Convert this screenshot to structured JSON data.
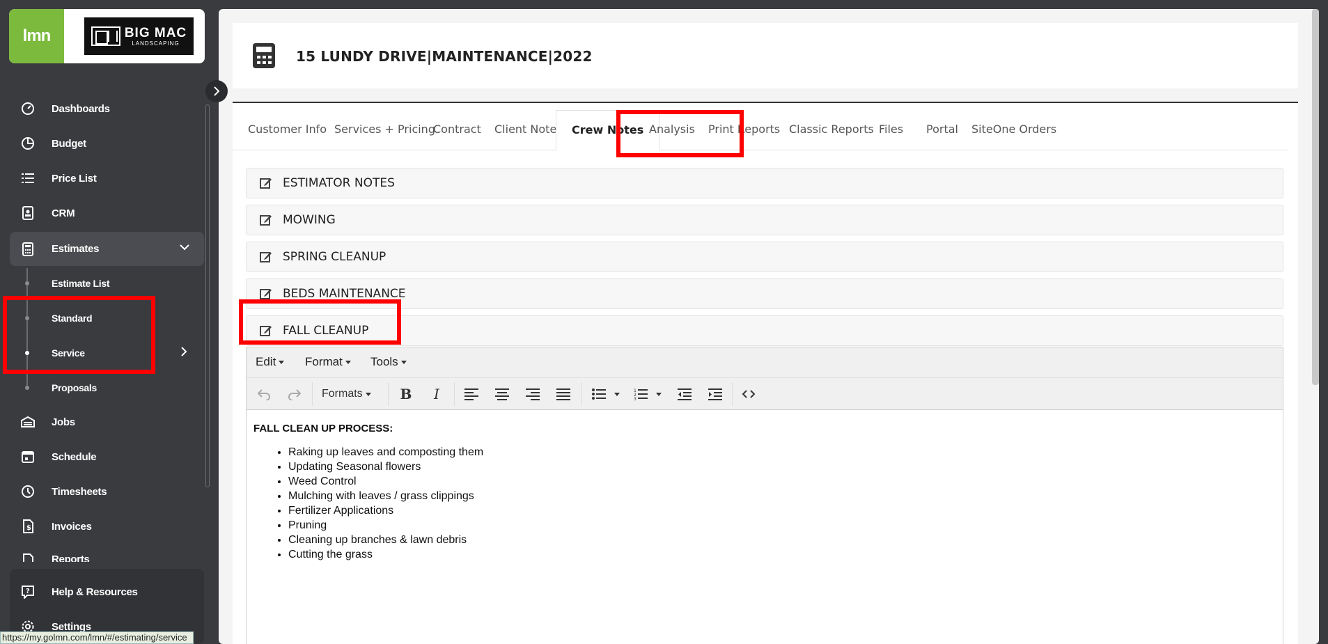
{
  "brand": {
    "lmn": "lmn",
    "company_big": "BIG MAC",
    "company_small": "LANDSCAPING"
  },
  "sidebar": {
    "items": [
      {
        "label": "Dashboards",
        "icon": "dashboard-gauge-icon"
      },
      {
        "label": "Budget",
        "icon": "pie-chart-icon"
      },
      {
        "label": "Price List",
        "icon": "list-icon"
      },
      {
        "label": "CRM",
        "icon": "contact-card-icon"
      },
      {
        "label": "Estimates",
        "icon": "calculator-icon"
      },
      {
        "label": "Jobs",
        "icon": "stack-icon"
      },
      {
        "label": "Schedule",
        "icon": "calendar-icon"
      },
      {
        "label": "Timesheets",
        "icon": "clock-icon"
      },
      {
        "label": "Invoices",
        "icon": "invoice-icon"
      },
      {
        "label": "Reports",
        "icon": "report-icon"
      }
    ],
    "estimates_sub": [
      "Estimate List",
      "Standard",
      "Service",
      "Proposals"
    ],
    "bottom": [
      {
        "label": "Help & Resources",
        "icon": "help-icon"
      },
      {
        "label": "Settings",
        "icon": "gear-icon"
      }
    ]
  },
  "status_url": "https://my.golmn.com/lmn/#/estimating/service",
  "page": {
    "title": "15 LUNDY DRIVE|MAINTENANCE|2022"
  },
  "tabs": [
    "Customer Info",
    "Services + Pricing",
    "Contract",
    "Client Notes",
    "Crew Notes",
    "Analysis",
    "Print Reports",
    "Classic Reports",
    "Files",
    "Portal",
    "SiteOne Orders"
  ],
  "active_tab": "Crew Notes",
  "panels": [
    "ESTIMATOR NOTES",
    "MOWING",
    "SPRING CLEANUP",
    "BEDS MAINTENANCE",
    "FALL CLEANUP"
  ],
  "editor": {
    "menus": [
      "Edit",
      "Format",
      "Tools"
    ],
    "formats_label": "Formats",
    "heading": "FALL CLEAN UP PROCESS:",
    "list": [
      "Raking up leaves and composting them",
      "Updating Seasonal flowers",
      "Weed Control",
      "Mulching with leaves / grass clippings",
      "Fertilizer Applications",
      "Pruning",
      "Cleaning up branches & lawn debris",
      "Cutting the grass"
    ]
  },
  "colors": {
    "brand_green": "#7cba3d",
    "sidebar_bg": "#3a3b3f",
    "highlight_red": "#ff0000"
  }
}
